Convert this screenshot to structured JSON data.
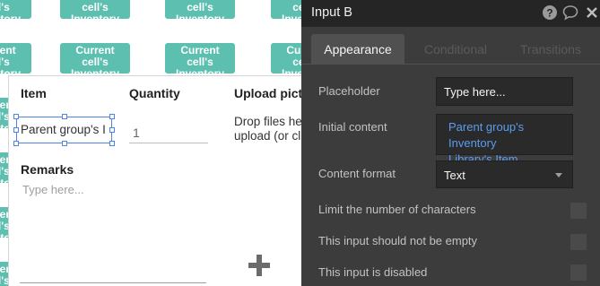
{
  "canvas": {
    "grid_button": {
      "line1": "Current",
      "line2": "cell's",
      "line3": "Inventory"
    }
  },
  "form": {
    "item_label": "Item",
    "item_value": "Parent group's I",
    "quantity_label": "Quantity",
    "quantity_value": "1",
    "upload_label": "Upload pictu",
    "upload_line1": "Drop files he",
    "upload_line2": "upload (or cl",
    "remarks_label": "Remarks",
    "remarks_placeholder": "Type here..."
  },
  "property_editor": {
    "title": "Input B",
    "header_icons": [
      "help-icon",
      "comment-icon",
      "close-icon"
    ],
    "tabs": [
      {
        "label": "Appearance",
        "active": true
      },
      {
        "label": "Conditional",
        "active": false
      },
      {
        "label": "Transitions",
        "active": false
      }
    ],
    "placeholder": {
      "label": "Placeholder",
      "value": "Type here..."
    },
    "initial_content": {
      "label": "Initial content",
      "line1": "Parent group's Inventory",
      "line2": "Library's Item"
    },
    "content_format": {
      "label": "Content format",
      "value": "Text"
    },
    "limit_characters": {
      "label": "Limit the number of characters",
      "checked": false
    },
    "not_empty": {
      "label": "This input should not be empty",
      "checked": false
    },
    "disabled": {
      "label": "This input is disabled",
      "checked": false
    }
  },
  "colors": {
    "grid_button": "#5cbfb0",
    "editor_bg": "#3c3c3c",
    "editor_header": "#252525",
    "dynamic_text": "#5a9df0",
    "selection": "#4a86e8"
  }
}
